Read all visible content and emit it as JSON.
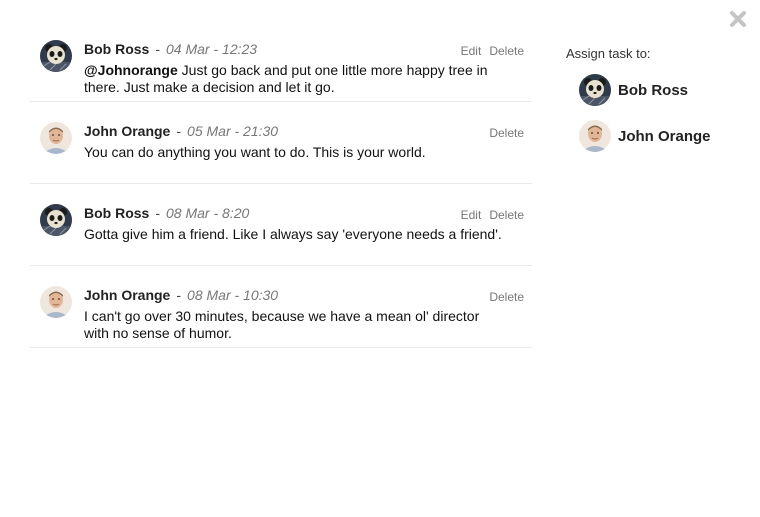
{
  "close_icon": "close-icon",
  "comments": [
    {
      "author": "Bob Ross",
      "separator": "-",
      "date": "04 Mar - 12:23",
      "mention": "@Johnorange",
      "text": " Just go back and put one little more happy tree in there. Just make a decision and let it go.",
      "edit_label": "Edit",
      "delete_label": "Delete",
      "avatar": "panda-avatar"
    },
    {
      "author": "John Orange",
      "separator": "-",
      "date": "05 Mar - 21:30",
      "mention": "",
      "text": "You can do anything you want to do. This is your world.",
      "delete_label": "Delete",
      "avatar": "person-avatar"
    },
    {
      "author": "Bob Ross",
      "separator": "-",
      "date": "08 Mar - 8:20",
      "mention": "",
      "text": "Gotta give him a friend. Like I always say 'everyone needs a friend'.",
      "edit_label": "Edit",
      "delete_label": "Delete",
      "avatar": "panda-avatar"
    },
    {
      "author": "John Orange",
      "separator": "-",
      "date": "08 Mar - 10:30",
      "mention": "",
      "text": "I can't go over 30 minutes, because we have a mean ol' director with no sense of humor.",
      "delete_label": "Delete",
      "avatar": "person-avatar"
    }
  ],
  "assign": {
    "label": "Assign task to:",
    "users": [
      {
        "name": "Bob Ross",
        "avatar": "panda-avatar"
      },
      {
        "name": "John Orange",
        "avatar": "person-avatar"
      }
    ]
  }
}
